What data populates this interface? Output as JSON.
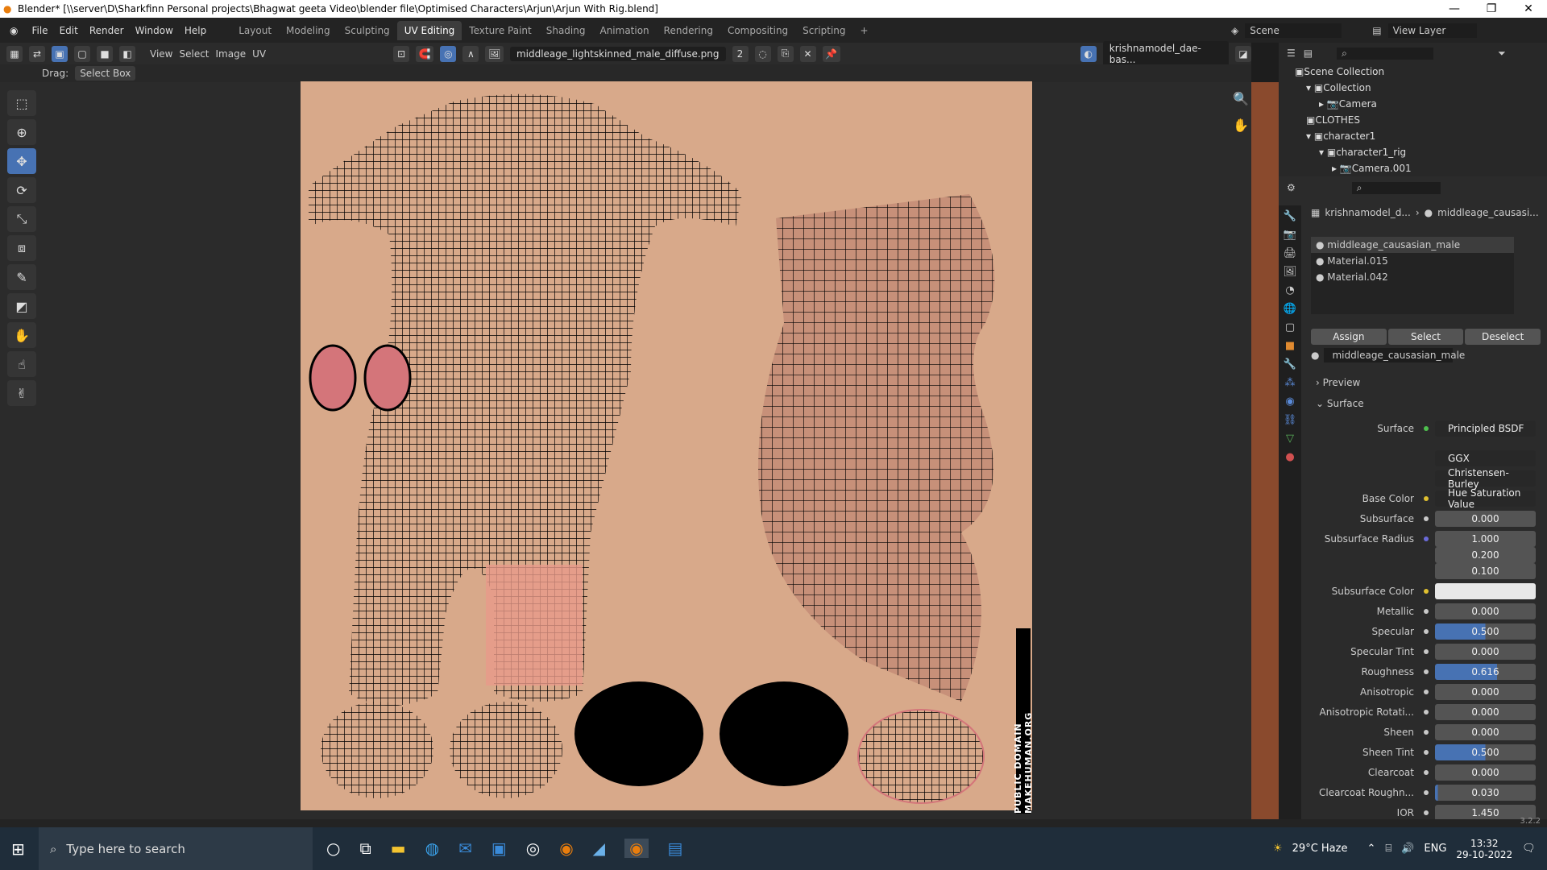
{
  "window": {
    "title": "Blender* [\\\\server\\D\\Sharkfinn Personal projects\\Bhagwat geeta Video\\blender file\\Optimised Characters\\Arjun\\Arjun With Rig.blend]"
  },
  "menu": {
    "items": [
      "File",
      "Edit",
      "Render",
      "Window",
      "Help"
    ]
  },
  "workspaces": [
    "Layout",
    "Modeling",
    "Sculpting",
    "UV Editing",
    "Texture Paint",
    "Shading",
    "Animation",
    "Rendering",
    "Compositing",
    "Scripting"
  ],
  "scene": {
    "label": "Scene",
    "view_layer": "View Layer"
  },
  "uv_header": {
    "view": "View",
    "select": "Select",
    "image": "Image",
    "uv": "UV",
    "image_name": "middleage_lightskinned_male_diffuse.png",
    "users": "2",
    "object_field": "krishnamodel_dae-bas..."
  },
  "drag": {
    "label": "Drag:",
    "value": "Select Box"
  },
  "outliner": {
    "items": [
      {
        "label": "Scene Collection",
        "indent": 0
      },
      {
        "label": "Collection",
        "indent": 1
      },
      {
        "label": "Camera",
        "indent": 2
      },
      {
        "label": "CLOTHES",
        "indent": 1
      },
      {
        "label": "character1",
        "indent": 1
      },
      {
        "label": "character1_rig",
        "indent": 2
      },
      {
        "label": "Camera.001",
        "indent": 3
      }
    ]
  },
  "props": {
    "breadcrumb_obj": "krishnamodel_d...",
    "breadcrumb_mat": "middleage_causasi...",
    "slots": [
      "middleage_causasian_male",
      "Material.015",
      "Material.042"
    ],
    "assign": "Assign",
    "select": "Select",
    "deselect": "Deselect",
    "material_name": "middleage_causasian_male",
    "preview": "Preview",
    "surface_panel": "Surface",
    "surface_label": "Surface",
    "surface_value": "Principled BSDF",
    "distribution": "GGX",
    "subsurface_method": "Christensen-Burley",
    "base_color_label": "Base Color",
    "base_color_value": "Hue Saturation Value",
    "rows": [
      {
        "label": "Subsurface",
        "value": "0.000"
      },
      {
        "label": "Subsurface Radius",
        "value": "1.000"
      },
      {
        "label": "",
        "value": "0.200"
      },
      {
        "label": "",
        "value": "0.100"
      },
      {
        "label": "Subsurface Color",
        "value": ""
      },
      {
        "label": "Metallic",
        "value": "0.000"
      },
      {
        "label": "Specular",
        "value": "0.500"
      },
      {
        "label": "Specular Tint",
        "value": "0.000"
      },
      {
        "label": "Roughness",
        "value": "0.616"
      },
      {
        "label": "Anisotropic",
        "value": "0.000"
      },
      {
        "label": "Anisotropic Rotati...",
        "value": "0.000"
      },
      {
        "label": "Sheen",
        "value": "0.000"
      },
      {
        "label": "Sheen Tint",
        "value": "0.500"
      },
      {
        "label": "Clearcoat",
        "value": "0.000"
      },
      {
        "label": "Clearcoat Roughn...",
        "value": "0.030"
      },
      {
        "label": "IOR",
        "value": "1.450"
      }
    ],
    "specular_fill": 0.5,
    "roughness_fill": 0.616,
    "sheen_tint_fill": 0.5,
    "clearcoat_r_fill": 0.03
  },
  "watermark": "PUBLIC DOMAIN MAKEHUMAN.ORG",
  "version": "3.2.2",
  "taskbar": {
    "search": "Type here to search",
    "weather": "29°C  Haze",
    "lang": "ENG",
    "time": "13:32",
    "date": "29-10-2022"
  }
}
